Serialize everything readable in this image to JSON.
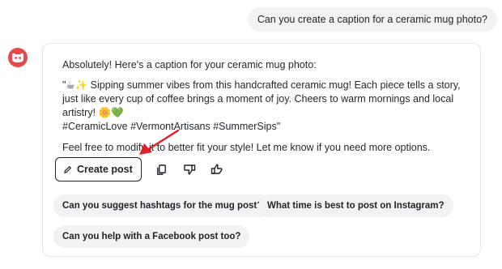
{
  "user_message": "Can you create a caption for a ceramic mug photo?",
  "assistant": {
    "intro": "Absolutely! Here's a caption for your ceramic mug photo:",
    "caption_lead": "\"☕✨ Sipping summer vibes from this handcrafted ceramic mug! Each piece tells a story, just like every cup of coffee brings a moment of joy. Cheers to warm mornings and local artistry! 🌼💚",
    "caption_tags": "#CeramicLove #VermontArtisans #SummerSips\"",
    "outro": "Feel free to modify it to better fit your style! Let me know if you need more options."
  },
  "actions": {
    "create_post_label": "Create post",
    "icons": [
      "copy-icon",
      "thumbs-down-icon",
      "thumbs-up-icon"
    ]
  },
  "suggestions": [
    "Can you suggest hashtags for the mug post?",
    "What time is best to post on Instagram?",
    "Can you help with a Facebook post too?"
  ],
  "colors": {
    "avatar_bg": "#e8474c",
    "annotation_arrow": "#e02020",
    "chip_bg": "#f1f2f4"
  }
}
